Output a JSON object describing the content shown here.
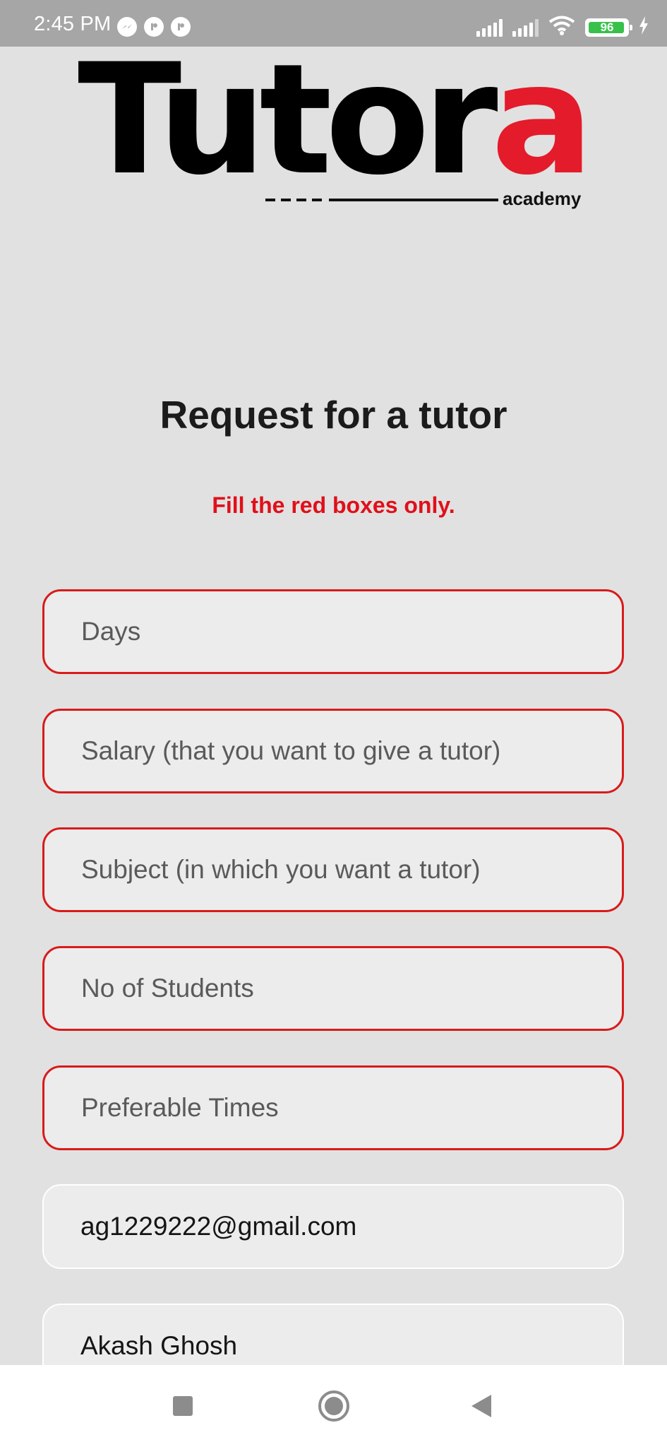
{
  "status_bar": {
    "time": "2:45 PM",
    "battery": "96",
    "battery_level_percent": 96,
    "icons": [
      "messenger-icon",
      "app-icon",
      "app-icon",
      "signal-icon",
      "signal-icon",
      "wifi-icon",
      "battery-icon",
      "charging-icon"
    ]
  },
  "logo": {
    "main": "Tutor",
    "accent": "a",
    "sub": "academy",
    "accent_color": "#e41b2a"
  },
  "title": "Request for a tutor",
  "note": "Fill the red boxes only.",
  "fields": [
    {
      "placeholder": "Days",
      "value": "",
      "required": true
    },
    {
      "placeholder": "Salary (that you want to give a tutor)",
      "value": "",
      "required": true
    },
    {
      "placeholder": "Subject (in which you want a tutor)",
      "value": "",
      "required": true
    },
    {
      "placeholder": "No of Students",
      "value": "",
      "required": true
    },
    {
      "placeholder": "Preferable Times",
      "value": "",
      "required": true
    },
    {
      "placeholder": "",
      "value": "ag1229222@gmail.com",
      "required": false
    },
    {
      "placeholder": "",
      "value": "Akash Ghosh",
      "required": false
    }
  ],
  "colors": {
    "required_border": "#d81b1b",
    "note": "#e0101a",
    "background": "#e1e1e1"
  },
  "nav_bar": [
    "recents-square-icon",
    "home-circle-icon",
    "back-triangle-icon"
  ]
}
